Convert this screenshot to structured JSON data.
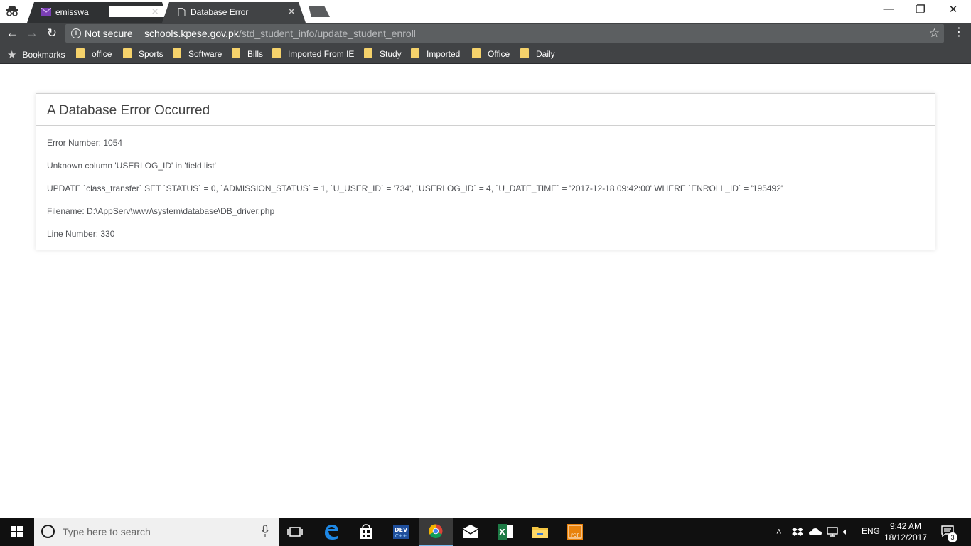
{
  "browser": {
    "tabs": [
      {
        "label": "emisswa",
        "active": false
      },
      {
        "label": "Database Error",
        "active": true
      }
    ],
    "tab_close_glyph": "✕",
    "security_label": "Not secure",
    "url_host": "schools.kpese.gov.pk",
    "url_path": "/std_student_info/update_student_enroll",
    "bookmarks": [
      "Bookmarks",
      "office",
      "Sports",
      "Software",
      "Bills",
      "Imported From IE",
      "Study",
      "Imported",
      "Office",
      "Daily"
    ]
  },
  "error": {
    "title": "A Database Error Occurred",
    "number": "Error Number: 1054",
    "message": "Unknown column 'USERLOG_ID' in 'field list'",
    "query": "UPDATE `class_transfer` SET `STATUS` = 0, `ADMISSION_STATUS` = 1, `U_USER_ID` = '734', `USERLOG_ID` = 4, `U_DATE_TIME` = '2017-12-18 09:42:00' WHERE `ENROLL_ID` = '195492'",
    "filename": "Filename: D:\\AppServ\\www\\system\\database\\DB_driver.php",
    "line": "Line Number: 330"
  },
  "taskbar": {
    "search_placeholder": "Type here to search",
    "language": "ENG",
    "time": "9:42 AM",
    "date": "18/12/2017",
    "notification_count": "3",
    "apps": [
      "task-view",
      "edge",
      "store",
      "devcpp",
      "chrome",
      "mail",
      "excel",
      "file-explorer",
      "pdf"
    ]
  },
  "colors": {
    "chrome_dark": "#414345",
    "taskbar": "#101010",
    "folder": "#f5d26b",
    "error_text": "#4f5155",
    "active_underline": "#76b9ed"
  }
}
